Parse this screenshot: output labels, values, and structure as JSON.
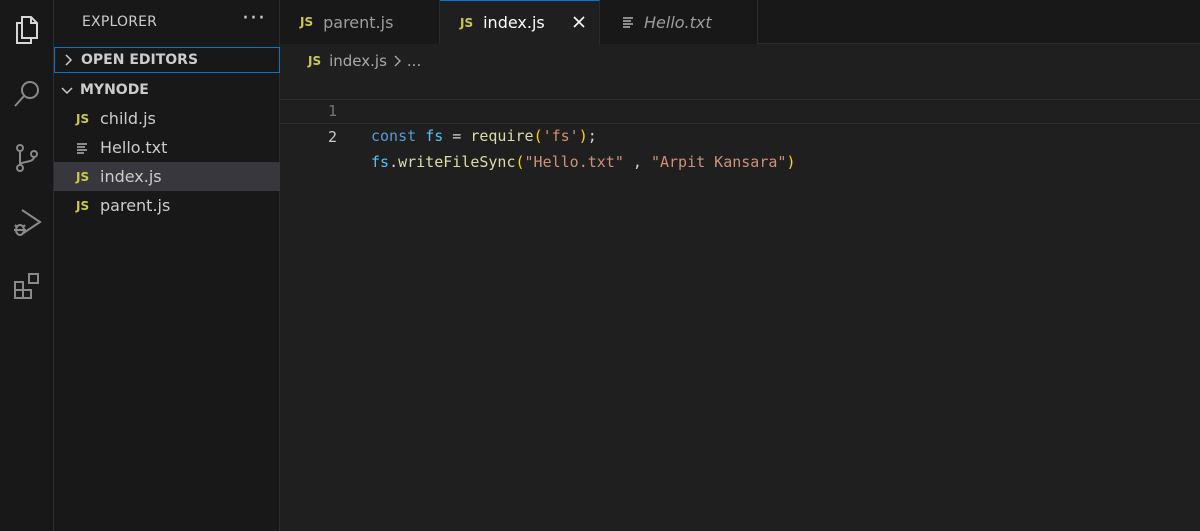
{
  "activity_bar": {
    "icons": [
      "explorer-icon",
      "search-icon",
      "source-control-icon",
      "run-debug-icon",
      "extensions-icon"
    ]
  },
  "sidebar": {
    "title": "EXPLORER",
    "more_actions": "···",
    "open_editors_label": "OPEN EDITORS",
    "folder_label": "MYNODE",
    "files": [
      {
        "name": "child.js",
        "type": "js"
      },
      {
        "name": "Hello.txt",
        "type": "txt"
      },
      {
        "name": "index.js",
        "type": "js",
        "selected": true
      },
      {
        "name": "parent.js",
        "type": "js"
      }
    ]
  },
  "js_badge": "JS",
  "tabs": [
    {
      "label": "parent.js",
      "type": "js",
      "active": false
    },
    {
      "label": "index.js",
      "type": "js",
      "active": true
    },
    {
      "label": "Hello.txt",
      "type": "txt",
      "active": false,
      "preview": true
    }
  ],
  "breadcrumb": {
    "file": "index.js",
    "more": "..."
  },
  "editor": {
    "current_line": 2,
    "lines": [
      {
        "number": "1",
        "tokens": [
          {
            "t": "const",
            "c": "kw"
          },
          {
            "t": " ",
            "c": "op"
          },
          {
            "t": "fs",
            "c": "var"
          },
          {
            "t": " = ",
            "c": "op"
          },
          {
            "t": "require",
            "c": "fn"
          },
          {
            "t": "(",
            "c": "paren"
          },
          {
            "t": "'fs'",
            "c": "str"
          },
          {
            "t": ")",
            "c": "paren"
          },
          {
            "t": ";",
            "c": "op"
          }
        ]
      },
      {
        "number": "2",
        "tokens": [
          {
            "t": "fs",
            "c": "var"
          },
          {
            "t": ".",
            "c": "op"
          },
          {
            "t": "writeFileSync",
            "c": "fn"
          },
          {
            "t": "(",
            "c": "paren"
          },
          {
            "t": "\"Hello.txt\"",
            "c": "str"
          },
          {
            "t": " , ",
            "c": "op"
          },
          {
            "t": "\"Arpit Kansara\"",
            "c": "str"
          },
          {
            "t": ")",
            "c": "paren"
          }
        ]
      }
    ]
  },
  "colors": {
    "accent": "#0078d4",
    "js_badge": "#cbcb41",
    "keyword": "#569cd6",
    "variable": "#4fc1ff",
    "function": "#dcdcaa",
    "string": "#ce9178",
    "bracket": "#ffd700"
  }
}
